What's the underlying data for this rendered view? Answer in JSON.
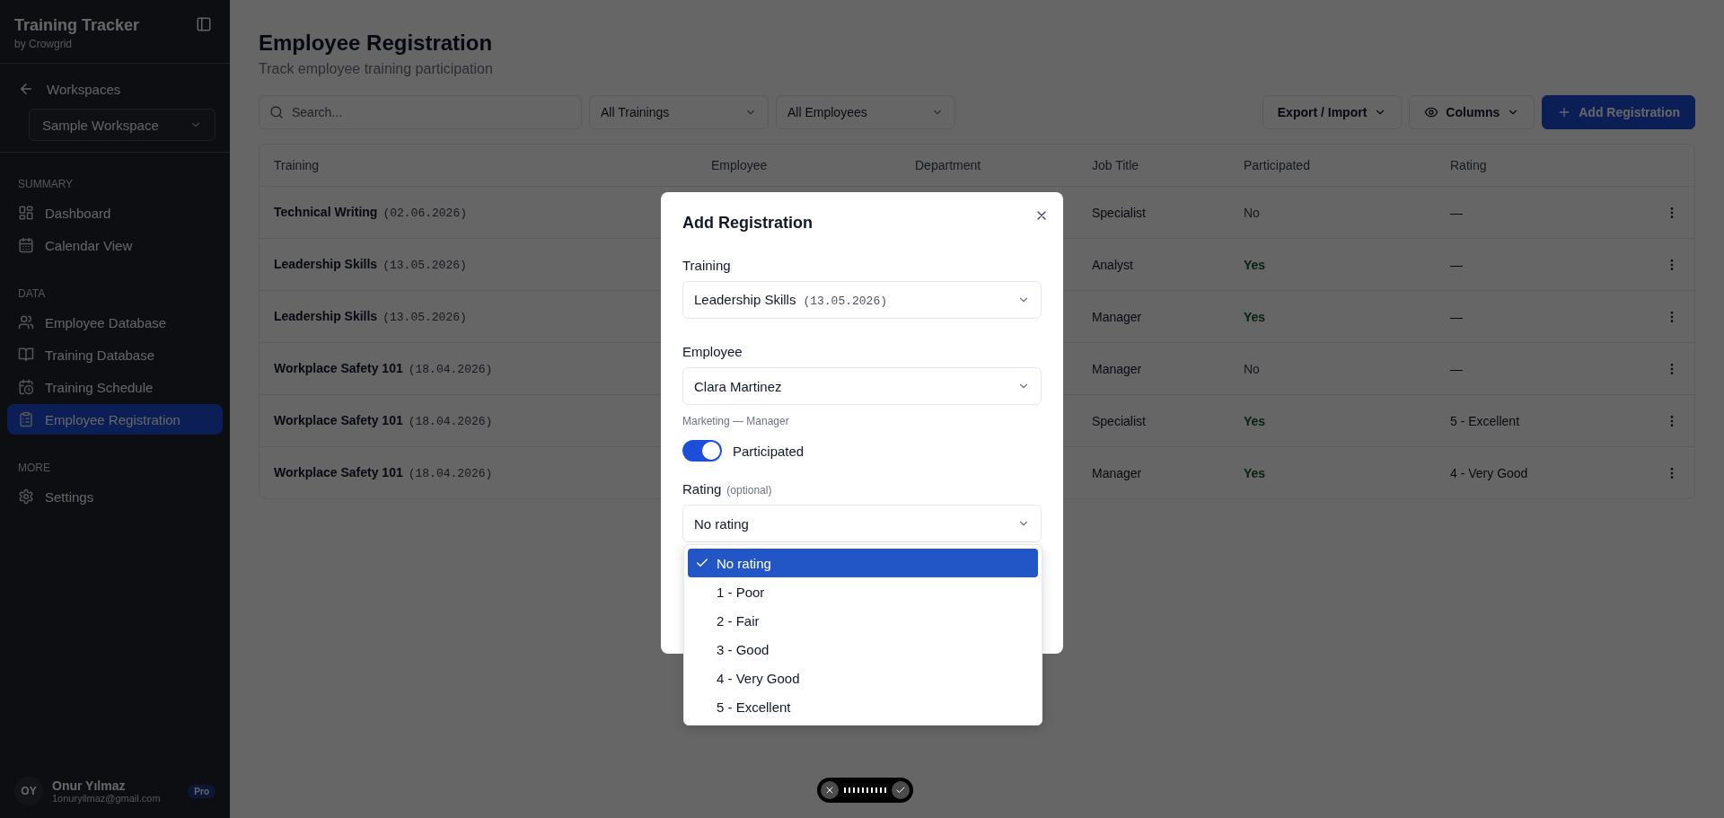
{
  "sidebar": {
    "app_title": "Training Tracker",
    "app_subtitle": "by Crowgrid",
    "back_label": "Workspaces",
    "workspace": "Sample Workspace",
    "sections": [
      {
        "heading": "SUMMARY",
        "items": [
          {
            "label": "Dashboard",
            "selected": false
          },
          {
            "label": "Calendar View",
            "selected": false
          }
        ]
      },
      {
        "heading": "DATA",
        "items": [
          {
            "label": "Employee Database",
            "selected": false
          },
          {
            "label": "Training Database",
            "selected": false
          },
          {
            "label": "Training Schedule",
            "selected": false
          },
          {
            "label": "Employee Registration",
            "selected": true
          }
        ]
      },
      {
        "heading": "MORE",
        "items": [
          {
            "label": "Settings",
            "selected": false
          }
        ]
      }
    ],
    "user": {
      "initials": "OY",
      "name": "Onur Yılmaz",
      "email": "1onuryilmaz@gmail.com",
      "badge": "Pro"
    }
  },
  "page": {
    "title": "Employee Registration",
    "subtitle": "Track employee training participation"
  },
  "toolbar": {
    "search_placeholder": "Search...",
    "filters": [
      "All Trainings",
      "All Employees"
    ],
    "export_button": "Export / Import",
    "columns_button": "Columns",
    "add_button": "Add Registration"
  },
  "table": {
    "columns": [
      "Training",
      "Employee",
      "Department",
      "Job Title",
      "Participated",
      "Rating"
    ],
    "rows": [
      {
        "training": "Technical Writing",
        "date": "(02.06.2026)",
        "job_title": "Specialist",
        "participated": false,
        "participated_text": "No",
        "rating": "—"
      },
      {
        "training": "Leadership Skills",
        "date": "(13.05.2026)",
        "job_title": "Analyst",
        "participated": true,
        "participated_text": "Yes",
        "rating": "—"
      },
      {
        "training": "Leadership Skills",
        "date": "(13.05.2026)",
        "job_title": "Manager",
        "participated": true,
        "participated_text": "Yes",
        "rating": "—"
      },
      {
        "training": "Workplace Safety 101",
        "date": "(18.04.2026)",
        "job_title": "Manager",
        "participated": false,
        "participated_text": "No",
        "rating": "—"
      },
      {
        "training": "Workplace Safety 101",
        "date": "(18.04.2026)",
        "job_title": "Specialist",
        "participated": true,
        "participated_text": "Yes",
        "rating": "5 - Excellent"
      },
      {
        "training": "Workplace Safety 101",
        "date": "(18.04.2026)",
        "job_title": "Manager",
        "participated": true,
        "participated_text": "Yes",
        "rating": "4 - Very Good"
      }
    ]
  },
  "modal": {
    "title": "Add Registration",
    "training": {
      "label": "Training",
      "value": "Leadership Skills",
      "date": "(13.05.2026)"
    },
    "employee": {
      "label": "Employee",
      "value": "Clara Martinez",
      "hint": "Marketing — Manager"
    },
    "participated": {
      "label": "Participated",
      "on": true
    },
    "rating": {
      "label": "Rating",
      "note": "(optional)",
      "value": "No rating",
      "options": [
        {
          "label": "No rating",
          "selected": true
        },
        {
          "label": "1 - Poor",
          "selected": false
        },
        {
          "label": "2 - Fair",
          "selected": false
        },
        {
          "label": "3 - Good",
          "selected": false
        },
        {
          "label": "4 - Very Good",
          "selected": false
        },
        {
          "label": "5 - Excellent",
          "selected": false
        }
      ]
    }
  }
}
